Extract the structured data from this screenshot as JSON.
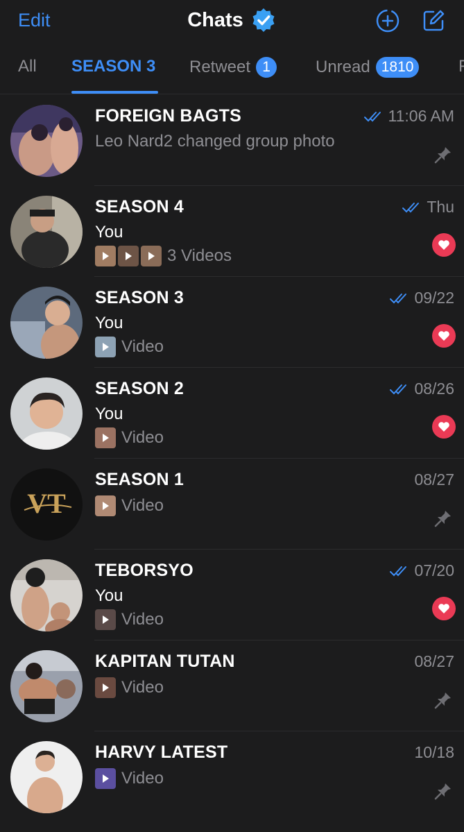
{
  "header": {
    "edit_label": "Edit",
    "title": "Chats",
    "accent_color": "#3e8ef7"
  },
  "tabs": [
    {
      "label": "All",
      "active": false
    },
    {
      "label": "SEASON 3",
      "active": true
    },
    {
      "label": "Retweet",
      "badge": "1",
      "active": false
    },
    {
      "label": "Unread",
      "badge": "1810",
      "active": false
    },
    {
      "label": "F",
      "active": false
    }
  ],
  "chats": [
    {
      "name": "FOREIGN BAGTS",
      "time": "11:06 AM",
      "read": true,
      "preview": "Leo Nard2 changed group photo",
      "status_icon": "pin-icon"
    },
    {
      "name": "SEASON 4",
      "time": "Thu",
      "read": true,
      "sender": "You",
      "media_label": "3 Videos",
      "status_icon": "heart-reaction-icon"
    },
    {
      "name": "SEASON 3",
      "time": "09/22",
      "read": true,
      "sender": "You",
      "media_label": "Video",
      "status_icon": "heart-reaction-icon"
    },
    {
      "name": "SEASON 2",
      "time": "08/26",
      "read": true,
      "sender": "You",
      "media_label": "Video",
      "status_icon": "heart-reaction-icon"
    },
    {
      "name": "SEASON 1",
      "time": "08/27",
      "read": false,
      "media_label": "Video",
      "status_icon": "pin-icon",
      "avatar_logo": "VT"
    },
    {
      "name": "TEBORSYO",
      "time": "07/20",
      "read": true,
      "sender": "You",
      "media_label": "Video",
      "status_icon": "heart-reaction-icon"
    },
    {
      "name": "KAPITAN TUTAN",
      "time": "08/27",
      "read": false,
      "media_label": "Video",
      "status_icon": "pin-icon"
    },
    {
      "name": "HARVY LATEST",
      "time": "10/18",
      "read": false,
      "media_label": "Video",
      "status_icon": "pin-icon"
    }
  ]
}
